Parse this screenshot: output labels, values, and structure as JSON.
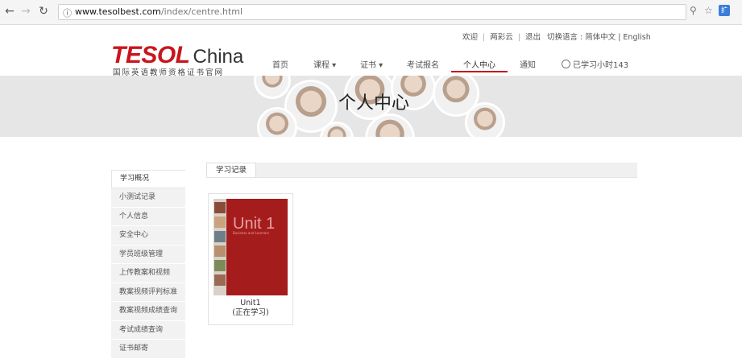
{
  "browser": {
    "url_host": "www.tesolbest.com",
    "url_path": "/index/centre.html"
  },
  "toplinks": {
    "welcome": "欢迎",
    "user": "两彩云",
    "logout": "退出",
    "language": "切换语言 : 简体中文 | English"
  },
  "logo": {
    "brand": "TESOL",
    "country": "China",
    "subtitle": "国际英语教师资格证书官网"
  },
  "nav": {
    "home": "首页",
    "courses": "课程 ▾",
    "certificates": "证书 ▾",
    "exam_signup": "考试报名",
    "personal_center": "个人中心",
    "notice": "通知",
    "study_hours": "已学习小时143"
  },
  "banner": {
    "title": "个人中心"
  },
  "sidebar": {
    "items": [
      {
        "label": "学习概况"
      },
      {
        "label": "小测试记录"
      },
      {
        "label": "个人信息"
      },
      {
        "label": "安全中心"
      },
      {
        "label": "学员班级管理"
      },
      {
        "label": "上传教案和视频"
      },
      {
        "label": "教案视频评判标准"
      },
      {
        "label": "教案视频成绩查询"
      },
      {
        "label": "考试成绩查询"
      },
      {
        "label": "证书邮寄"
      }
    ]
  },
  "tabs": {
    "study_record": "学习记录"
  },
  "course": {
    "cover_title": "Unit 1",
    "cover_subtitle": "Business and Learners",
    "name": "Unit1",
    "status": "(正在学习)"
  },
  "colors": {
    "brand_red": "#c8161d",
    "cover_red": "#a51c1c"
  }
}
